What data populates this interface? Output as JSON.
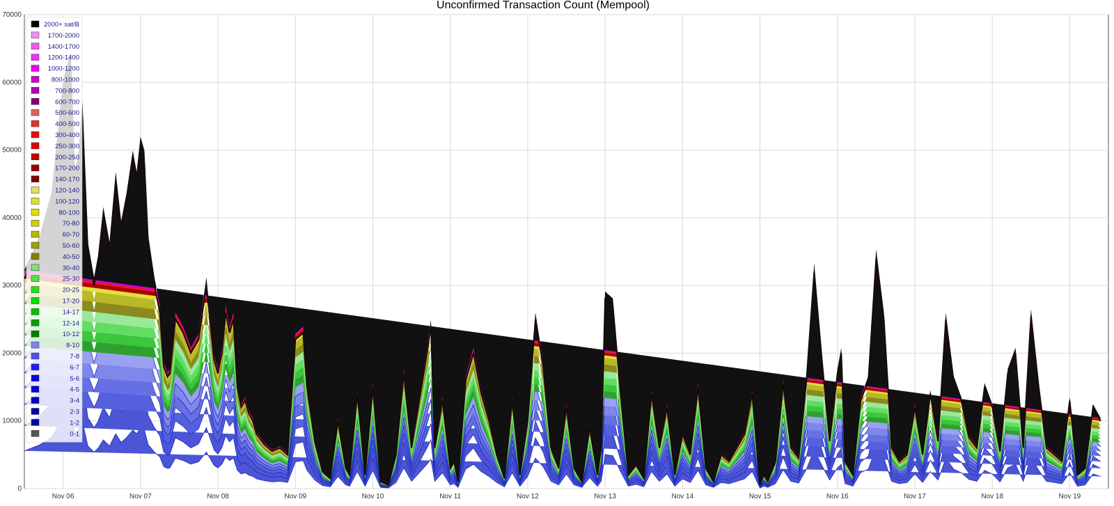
{
  "chart_data": {
    "type": "area",
    "title": "Unconfirmed Transaction Count (Mempool)",
    "xlabel": "",
    "ylabel": "",
    "ylim": [
      0,
      70000
    ],
    "xlim": [
      5.5,
      19.5
    ],
    "y_ticks": [
      0,
      10000,
      20000,
      30000,
      40000,
      50000,
      60000,
      70000
    ],
    "x_ticks": [
      {
        "at": 6,
        "label": "Nov 06"
      },
      {
        "at": 7,
        "label": "Nov 07"
      },
      {
        "at": 8,
        "label": "Nov 08"
      },
      {
        "at": 9,
        "label": "Nov 09"
      },
      {
        "at": 10,
        "label": "Nov 10"
      },
      {
        "at": 11,
        "label": "Nov 11"
      },
      {
        "at": 12,
        "label": "Nov 12"
      },
      {
        "at": 13,
        "label": "Nov 13"
      },
      {
        "at": 14,
        "label": "Nov 14"
      },
      {
        "at": 15,
        "label": "Nov 15"
      },
      {
        "at": 16,
        "label": "Nov 16"
      },
      {
        "at": 17,
        "label": "Nov 17"
      },
      {
        "at": 18,
        "label": "Nov 18"
      },
      {
        "at": 19,
        "label": "Nov 19"
      }
    ],
    "grid": true,
    "legend_position": "top-left",
    "legend": [
      {
        "label": "2000+ sat/B",
        "color": "#000000"
      },
      {
        "label": "1700-2000",
        "color": "#f08ef0"
      },
      {
        "label": "1400-1700",
        "color": "#f05af0"
      },
      {
        "label": "1200-1400",
        "color": "#f030f0"
      },
      {
        "label": "1000-1200",
        "color": "#f000f0"
      },
      {
        "label": "800-1000",
        "color": "#d000d0"
      },
      {
        "label": "700-800",
        "color": "#b000b0"
      },
      {
        "label": "600-700",
        "color": "#800080"
      },
      {
        "label": "500-600",
        "color": "#e06060"
      },
      {
        "label": "400-500",
        "color": "#e03030"
      },
      {
        "label": "300-400",
        "color": "#e01010"
      },
      {
        "label": "250-300",
        "color": "#e00000"
      },
      {
        "label": "200-250",
        "color": "#c00000"
      },
      {
        "label": "170-200",
        "color": "#a00000"
      },
      {
        "label": "140-170",
        "color": "#800000"
      },
      {
        "label": "120-140",
        "color": "#e0e060"
      },
      {
        "label": "100-120",
        "color": "#e0e030"
      },
      {
        "label": "80-100",
        "color": "#e0e000"
      },
      {
        "label": "70-80",
        "color": "#d0d000"
      },
      {
        "label": "60-70",
        "color": "#b8b800"
      },
      {
        "label": "50-60",
        "color": "#a0a000"
      },
      {
        "label": "40-50",
        "color": "#808000"
      },
      {
        "label": "30-40",
        "color": "#80e080"
      },
      {
        "label": "25-30",
        "color": "#50e050"
      },
      {
        "label": "20-25",
        "color": "#20e020"
      },
      {
        "label": "17-20",
        "color": "#00e000"
      },
      {
        "label": "14-17",
        "color": "#00c000"
      },
      {
        "label": "12-14",
        "color": "#00a000"
      },
      {
        "label": "10-12",
        "color": "#008000"
      },
      {
        "label": "8-10",
        "color": "#8080f0"
      },
      {
        "label": "7-8",
        "color": "#5050f0"
      },
      {
        "label": "6-7",
        "color": "#2020f0"
      },
      {
        "label": "5-6",
        "color": "#0000f0"
      },
      {
        "label": "4-5",
        "color": "#0000d0"
      },
      {
        "label": "3-4",
        "color": "#0000c0"
      },
      {
        "label": "2-3",
        "color": "#0000b0"
      },
      {
        "label": "1-2",
        "color": "#0000a0"
      },
      {
        "label": "0-1",
        "color": "#555555"
      }
    ],
    "total_series": {
      "x": [
        5.5,
        5.7,
        5.85,
        6.0,
        6.1,
        6.15,
        6.2,
        6.25,
        6.32,
        6.4,
        6.45,
        6.52,
        6.6,
        6.68,
        6.75,
        6.82,
        6.9,
        6.95,
        7.0,
        7.05,
        7.1,
        7.18,
        7.25,
        7.3,
        7.35,
        7.38,
        7.45,
        7.55,
        7.65,
        7.75,
        7.85,
        7.95,
        8.0,
        8.05,
        8.1,
        8.15,
        8.2,
        8.25,
        8.3,
        8.35,
        8.4,
        8.45,
        8.5,
        8.6,
        8.7,
        8.8,
        8.9,
        9.0,
        9.1,
        9.15,
        9.25,
        9.35,
        9.45,
        9.55,
        9.65,
        9.7,
        9.8,
        9.9,
        10.0,
        10.1,
        10.2,
        10.3,
        10.4,
        10.5,
        10.6,
        10.7,
        10.75,
        10.8,
        10.9,
        11.0,
        11.05,
        11.1,
        11.2,
        11.3,
        11.4,
        11.5,
        11.6,
        11.7,
        11.8,
        11.9,
        12.0,
        12.1,
        12.2,
        12.3,
        12.4,
        12.5,
        12.6,
        12.7,
        12.8,
        12.9,
        12.95,
        13.0,
        13.1,
        13.2,
        13.3,
        13.4,
        13.5,
        13.6,
        13.7,
        13.8,
        13.9,
        14.0,
        14.1,
        14.2,
        14.3,
        14.4,
        14.5,
        14.6,
        14.7,
        14.8,
        14.9,
        15.0,
        15.05,
        15.1,
        15.2,
        15.3,
        15.4,
        15.5,
        15.6,
        15.7,
        15.8,
        15.9,
        16.0,
        16.05,
        16.1,
        16.2,
        16.3,
        16.4,
        16.5,
        16.6,
        16.7,
        16.8,
        16.9,
        17.0,
        17.1,
        17.2,
        17.3,
        17.4,
        17.5,
        17.6,
        17.7,
        17.8,
        17.9,
        18.0,
        18.1,
        18.2,
        18.3,
        18.4,
        18.5,
        18.6,
        18.7,
        18.8,
        18.9,
        19.0,
        19.1,
        19.2,
        19.3,
        19.4,
        19.5
      ],
      "y": [
        31000,
        36000,
        42000,
        58000,
        62000,
        45000,
        48000,
        55000,
        35000,
        30000,
        33000,
        40000,
        35000,
        45000,
        38000,
        42000,
        48000,
        45000,
        50000,
        48000,
        36000,
        30000,
        26000,
        18000,
        16500,
        17000,
        25000,
        23000,
        20000,
        22000,
        30000,
        19000,
        17000,
        20000,
        26000,
        23000,
        25000,
        15000,
        12000,
        13000,
        11000,
        10000,
        8000,
        6500,
        5500,
        6000,
        5000,
        22000,
        23000,
        15000,
        7000,
        2500,
        1500,
        10000,
        3000,
        2000,
        14000,
        2000,
        15000,
        1000,
        500,
        5000,
        17000,
        6000,
        13000,
        20000,
        24000,
        6000,
        13000,
        3000,
        4000,
        1000,
        16000,
        20000,
        14000,
        10000,
        5000,
        1500,
        13000,
        2000,
        10000,
        25000,
        18000,
        6000,
        3000,
        12000,
        3000,
        1000,
        9000,
        2000,
        6000,
        28000,
        27000,
        14000,
        2000,
        3500,
        1500,
        14000,
        6000,
        12000,
        2000,
        8000,
        5000,
        15000,
        3000,
        1000,
        5000,
        4000,
        6000,
        8000,
        14000,
        500,
        2000,
        1000,
        4000,
        15500,
        6000,
        4500,
        16000,
        32000,
        19000,
        7000,
        17000,
        20000,
        4000,
        2000,
        13000,
        16000,
        34000,
        25000,
        6000,
        4000,
        5000,
        12000,
        5000,
        14000,
        7000,
        25000,
        16000,
        13000,
        7500,
        6000,
        15000,
        12000,
        5500,
        17000,
        20000,
        6000,
        25500,
        15000,
        6000,
        5000,
        4000,
        13000,
        2000,
        3000,
        12000,
        10000
      ]
    }
  }
}
